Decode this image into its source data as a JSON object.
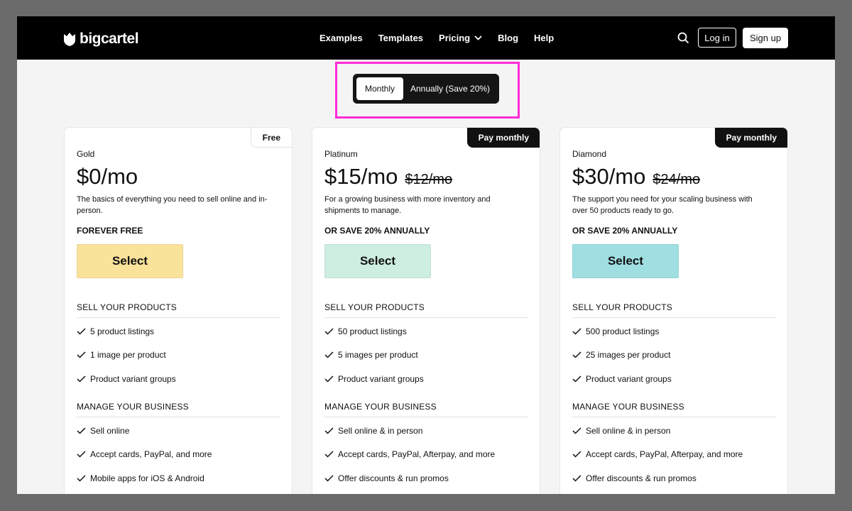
{
  "brand": {
    "name": "bigcartel"
  },
  "nav": [
    {
      "label": "Examples",
      "has_dropdown": false
    },
    {
      "label": "Templates",
      "has_dropdown": false
    },
    {
      "label": "Pricing",
      "has_dropdown": true
    },
    {
      "label": "Blog",
      "has_dropdown": false
    },
    {
      "label": "Help",
      "has_dropdown": false
    }
  ],
  "header": {
    "login_label": "Log in",
    "signup_label": "Sign up",
    "search_icon": "search-icon"
  },
  "billing_toggle": {
    "monthly_label": "Monthly",
    "annual_label": "Annually (Save 20%)",
    "selected": "Monthly"
  },
  "colors": {
    "accent_highlight": "#ff2bd6",
    "gold_button": "#f9e29a",
    "platinum_button": "#cdeee0",
    "diamond_button": "#9fdfe1"
  },
  "plans": [
    {
      "badge": "Free",
      "name": "Gold",
      "price": "$0/mo",
      "old_price": "",
      "description": "The basics of everything you need to sell online and in-person.",
      "billing_note": "FOREVER FREE",
      "select_label": "Select",
      "sections": [
        {
          "title": "SELL YOUR PRODUCTS",
          "items": [
            "5 product listings",
            "1 image per product",
            "Product variant groups"
          ]
        },
        {
          "title": "MANAGE YOUR BUSINESS",
          "items": [
            "Sell online",
            "Accept cards, PayPal, and more",
            "Mobile apps for iOS & Android"
          ]
        }
      ]
    },
    {
      "badge": "Pay monthly",
      "name": "Platinum",
      "price": "$15/mo",
      "old_price": "$12/mo",
      "description": "For a growing business with more inventory and shipments to manage.",
      "billing_note": "OR SAVE 20% ANNUALLY",
      "select_label": "Select",
      "sections": [
        {
          "title": "SELL YOUR PRODUCTS",
          "items": [
            "50 product listings",
            "5 images per product",
            "Product variant groups"
          ]
        },
        {
          "title": "MANAGE YOUR BUSINESS",
          "items": [
            "Sell online & in person",
            "Accept cards, PayPal, Afterpay, and more",
            "Offer discounts & run promos"
          ]
        }
      ]
    },
    {
      "badge": "Pay monthly",
      "name": "Diamond",
      "price": "$30/mo",
      "old_price": "$24/mo",
      "description": "The support you need for your scaling business with over 50 products ready to go.",
      "billing_note": "OR SAVE 20% ANNUALLY",
      "select_label": "Select",
      "sections": [
        {
          "title": "SELL YOUR PRODUCTS",
          "items": [
            "500 product listings",
            "25 images per product",
            "Product variant groups"
          ]
        },
        {
          "title": "MANAGE YOUR BUSINESS",
          "items": [
            "Sell online & in person",
            "Accept cards, PayPal, Afterpay, and more",
            "Offer discounts & run promos"
          ]
        }
      ]
    }
  ]
}
